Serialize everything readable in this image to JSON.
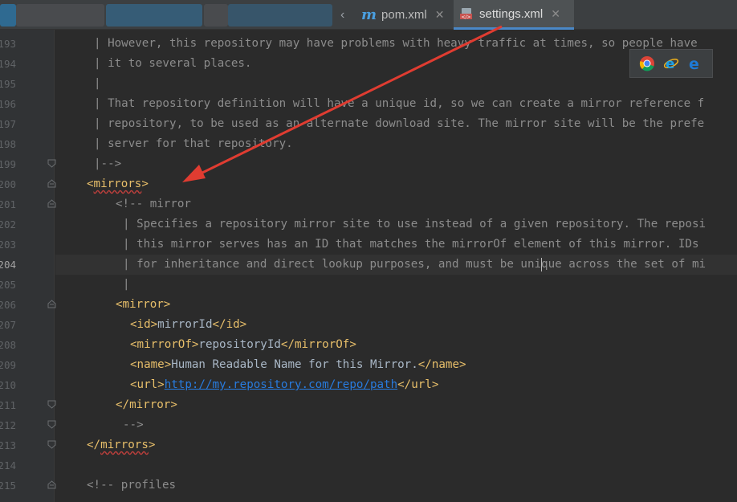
{
  "tabs": [
    {
      "label": "pom.xml",
      "close": "✕",
      "icon": "maven-m-icon"
    },
    {
      "label": "settings.xml",
      "close": "✕",
      "icon": "xml-file-icon"
    }
  ],
  "tab_chevron": "‹",
  "gutter": {
    "lines": [
      "193",
      "194",
      "195",
      "196",
      "197",
      "198",
      "199",
      "200",
      "201",
      "202",
      "203",
      "204",
      "205",
      "206",
      "207",
      "208",
      "209",
      "210",
      "211",
      "212",
      "213",
      "214",
      "215"
    ],
    "current_line": "204"
  },
  "code": {
    "l193": "| However, this repository may have problems with heavy traffic at times, so people have",
    "l194": "| it to several places.",
    "l195": "|",
    "l196": "| That repository definition will have a unique id, so we can create a mirror reference f",
    "l197": "| repository, to be used as an alternate download site. The mirror site will be the prefe",
    "l198": "| server for that repository.",
    "l199": "|-->",
    "l200_open": "<",
    "l200_name": "mirrors",
    "l200_close": ">",
    "l201": "<!-- mirror",
    "l202": "| Specifies a repository mirror site to use instead of a given repository. The reposi",
    "l203": "| this mirror serves has an ID that matches the mirrorOf element of this mirror. IDs",
    "l204_a": "| for inheritance and direct lookup purposes, and must be uni",
    "l204_b": "que across the set of mi",
    "l205": "|",
    "l206": "<mirror>",
    "l207_open": "<id>",
    "l207_val": "mirrorId",
    "l207_close": "</id>",
    "l208_open": "<mirrorOf>",
    "l208_val": "repositoryId",
    "l208_close": "</mirrorOf>",
    "l209_open": "<name>",
    "l209_val": "Human Readable Name for this Mirror.",
    "l209_close": "</name>",
    "l210_open": "<url>",
    "l210_val": "http://my.repository.com/repo/path",
    "l210_close": "</url>",
    "l211": "</mirror>",
    "l212": "-->",
    "l213_open": "</",
    "l213_name": "mirrors",
    "l213_close": ">",
    "l215": "<!-- profiles"
  },
  "browser_icons": [
    "chrome-icon",
    "ie-icon",
    "edge-icon"
  ],
  "colors": {
    "background": "#2b2b2b",
    "gutter": "#313335",
    "tag": "#e8bf6a",
    "comment": "#8c8c8c",
    "text": "#a9b7c6",
    "link": "#287bde",
    "annotation_arrow": "#e03c31"
  }
}
